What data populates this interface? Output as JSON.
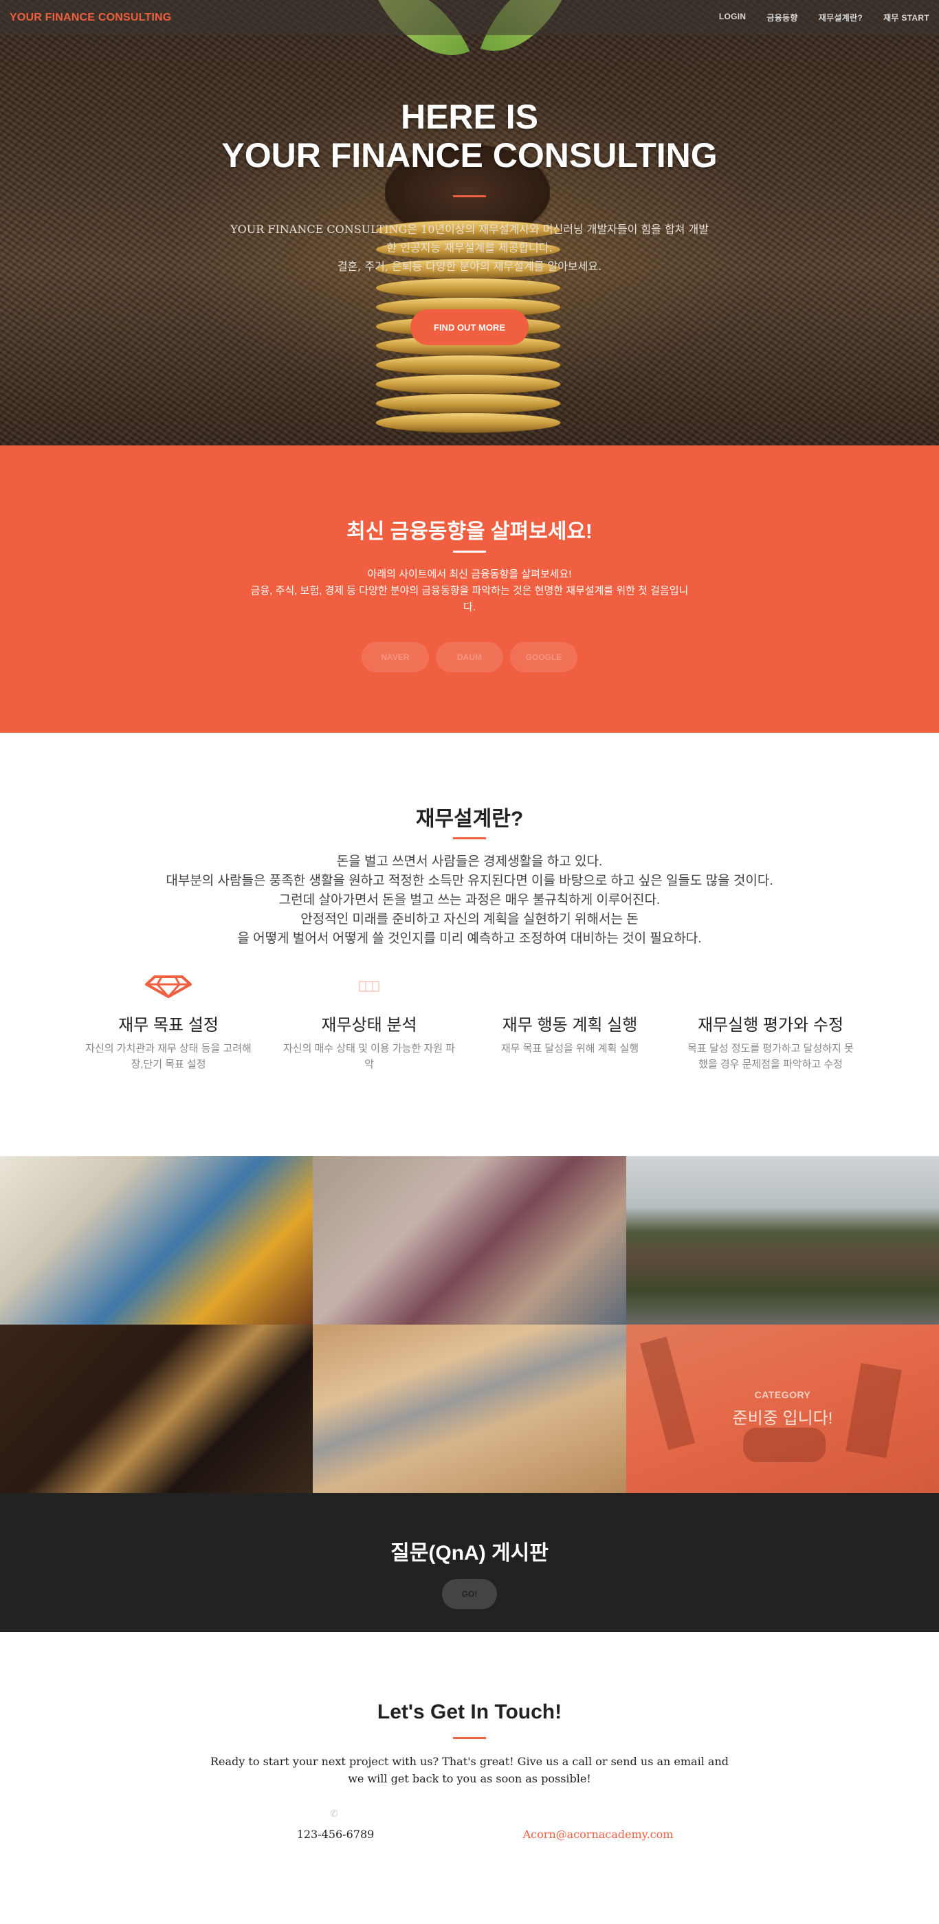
{
  "nav": {
    "brand": "YOUR FINANCE CONSULTING",
    "links": [
      "LOGIN",
      "금융동향",
      "재무설계란?",
      "재무 START"
    ]
  },
  "hero": {
    "title_line1": "HERE IS",
    "title_line2": "YOUR FINANCE CONSULTING",
    "desc_line1": "YOUR FINANCE CONSULTING은 10년이상의 재무설계사와 머신러닝 개발자들이 힘을 합쳐 개발",
    "desc_line2": "한 인공지능 재무설계를 제공합니다.",
    "desc_line3": "결혼, 주거, 은퇴등 다양한 분야의 재무설계를 알아보세요.",
    "button": "FIND OUT MORE"
  },
  "news": {
    "title": "최신 금융동향을 살펴보세요!",
    "desc_line1": "아래의 사이트에서 최신 금융동향을 살펴보세요!",
    "desc_line2": "금융, 주식, 보험, 경제 등 다양한 분야의 금융동향을 파악하는 것은 현명한 재무설계를 위한 첫 걸음입니",
    "desc_line3": "다.",
    "buttons": [
      "NAVER",
      "DAUM",
      "GOOGLE"
    ]
  },
  "about": {
    "title": "재무설계란?",
    "lines": [
      "돈을 벌고 쓰면서 사람들은 경제생활을 하고 있다.",
      "대부분의 사람들은 풍족한 생활을 원하고 적정한 소득만 유지된다면 이를 바탕으로 하고 싶은 일들도 많을 것이다.",
      "그런데 살아가면서 돈을 벌고 쓰는 과정은 매우 불규칙하게 이루어진다.",
      "안정적인 미래를 준비하고 자신의 계획을 실현하기 위해서는 돈",
      "을 어떻게 벌어서 어떻게 쓸 것인지를 미리 예측하고 조정하여 대비하는 것이 필요하다."
    ],
    "services": [
      {
        "title": "재무 목표 설정",
        "desc": "자신의 가치관과 재무 상태 등을 고려해 장,단기 목표 설정",
        "icon": "diamond-icon"
      },
      {
        "title": "재무상태 분석",
        "desc": "자신의 매수 상태 및 이용 가능한 자원 파악",
        "icon": "broken-image-icon"
      },
      {
        "title": "재무 행동 계획 실행",
        "desc": "재무 목표 달성을 위해 계획 실행",
        "icon": ""
      },
      {
        "title": "재무실행 평가와 수정",
        "desc": "목표 달성 정도를 평가하고 달성하지 못했을 경우 문제점을 파악하고 수정",
        "icon": ""
      }
    ]
  },
  "gallery": {
    "category_label": "CATEGORY",
    "category_name": "준비중 입니다!"
  },
  "qna": {
    "title": "질문(QnA) 게시판",
    "button": "GO!"
  },
  "contact": {
    "title": "Let's Get In Touch!",
    "desc_line1": "Ready to start your next project with us? That's great! Give us a call or send us an email and",
    "desc_line2": "we will get back to you as soon as possible!",
    "phone": "123-456-6789",
    "email": "Acorn@acornacademy.com"
  },
  "colors": {
    "accent": "#f05f40",
    "dark": "#222222"
  }
}
